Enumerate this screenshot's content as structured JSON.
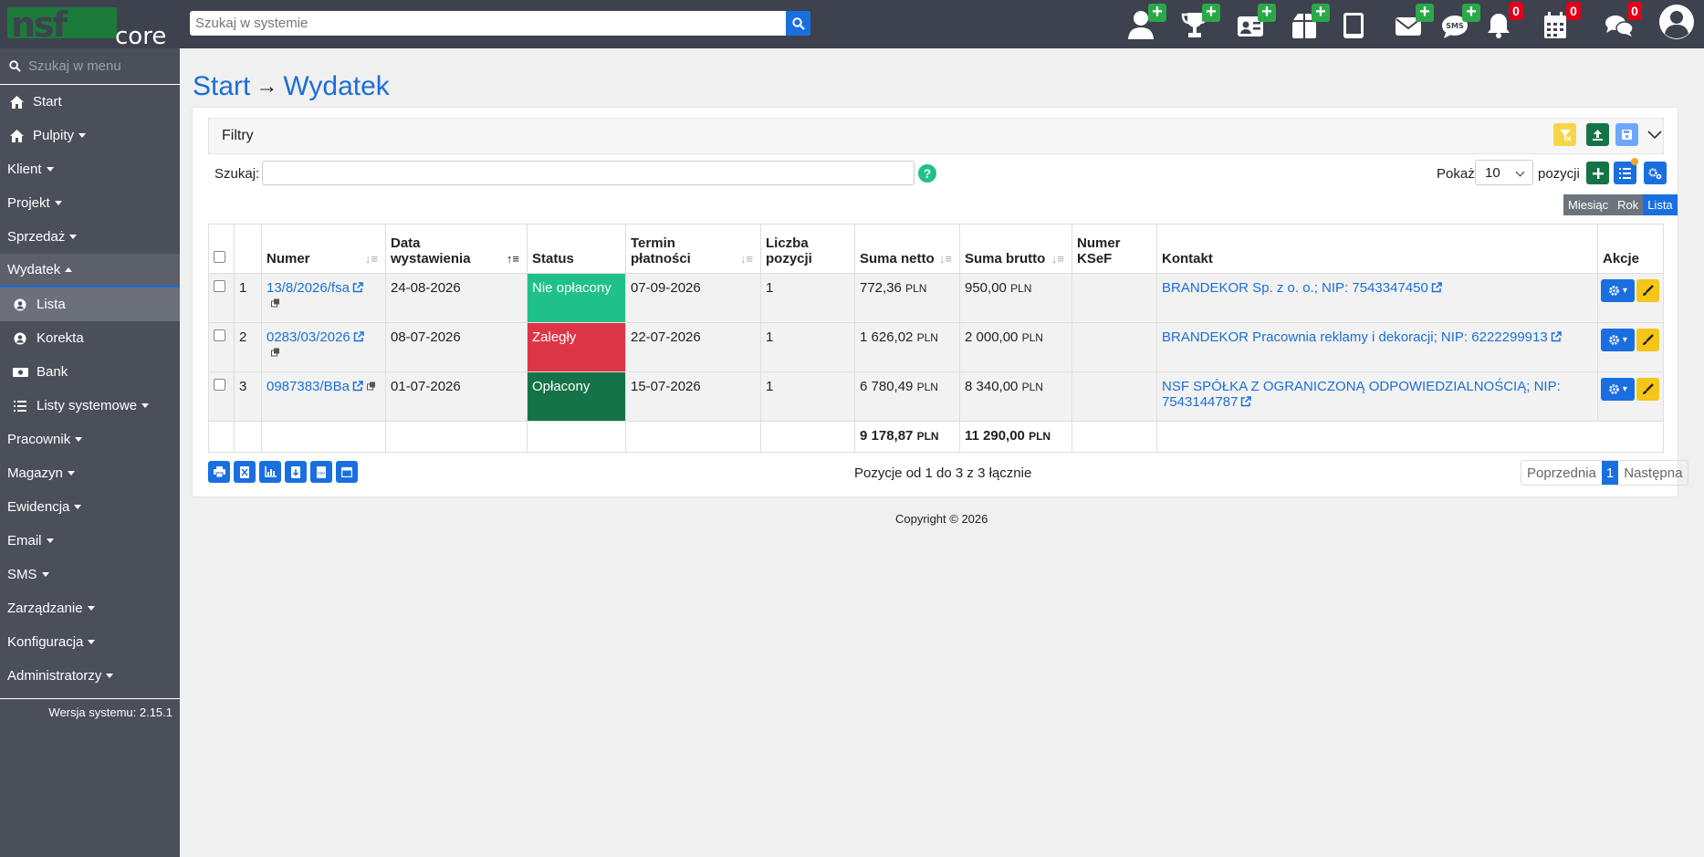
{
  "topbar": {
    "search_placeholder": "Szukaj w systemie",
    "badges": {
      "notifications": "0",
      "calendar": "0",
      "messages": "0"
    }
  },
  "sidebar": {
    "search_placeholder": "Szukaj w menu",
    "items": [
      {
        "label": "Start",
        "icon": "home-icon"
      },
      {
        "label": "Pulpity",
        "icon": "home-icon",
        "dropdown": true
      },
      {
        "label": "Klient",
        "dropdown": true
      },
      {
        "label": "Projekt",
        "dropdown": true
      },
      {
        "label": "Sprzedaż",
        "dropdown": true
      },
      {
        "label": "Wydatek",
        "dropdown": true,
        "expanded": true
      },
      {
        "label": "Lista",
        "icon": "person-icon",
        "sub": true,
        "active": true
      },
      {
        "label": "Korekta",
        "icon": "person-icon",
        "sub": true
      },
      {
        "label": "Bank",
        "icon": "money-icon",
        "sub": true
      },
      {
        "label": "Listy systemowe",
        "icon": "list-icon",
        "sub": true,
        "dropdown": true
      },
      {
        "label": "Pracownik",
        "dropdown": true
      },
      {
        "label": "Magazyn",
        "dropdown": true
      },
      {
        "label": "Ewidencja",
        "dropdown": true
      },
      {
        "label": "Email",
        "dropdown": true
      },
      {
        "label": "SMS",
        "dropdown": true
      },
      {
        "label": "Zarządzanie",
        "dropdown": true
      },
      {
        "label": "Konfiguracja",
        "dropdown": true
      },
      {
        "label": "Administratorzy",
        "dropdown": true
      }
    ],
    "version": "Wersja systemu: 2.15.1"
  },
  "breadcrumb": {
    "start": "Start",
    "current": "Wydatek"
  },
  "filters": {
    "title": "Filtry",
    "search_label": "Szukaj:",
    "help": "?",
    "show_label": "Pokaż",
    "page_size": "10",
    "positions_label": "pozycji",
    "views": [
      "Miesiąc",
      "Rok",
      "Lista"
    ],
    "active_view": "Lista"
  },
  "table": {
    "headers": {
      "numer": "Numer",
      "data": "Data wystawienia",
      "status": "Status",
      "termin": "Termin płatności",
      "liczba": "Liczba pozycji",
      "netto": "Suma netto",
      "brutto": "Suma brutto",
      "ksef": "Numer KSeF",
      "kontakt": "Kontakt",
      "akcje": "Akcje"
    },
    "rows": [
      {
        "lp": "1",
        "numer": "13/8/2026/fsa",
        "data": "24-08-2026",
        "status": "Nie opłacony",
        "termin": "07-09-2026",
        "liczba": "1",
        "netto": "772,36",
        "brutto": "950,00",
        "ksef": "",
        "kontakt": "BRANDEKOR Sp. z o. o.; NIP: 7543347450"
      },
      {
        "lp": "2",
        "numer": "0283/03/2026",
        "data": "08-07-2026",
        "status": "Zaległy",
        "termin": "22-07-2026",
        "liczba": "1",
        "netto": "1 626,02",
        "brutto": "2 000,00",
        "ksef": "",
        "kontakt": "BRANDEKOR Pracownia reklamy i dekoracji; NIP: 6222299913"
      },
      {
        "lp": "3",
        "numer": "0987383/BBa",
        "data": "01-07-2026",
        "status": "Opłacony",
        "termin": "15-07-2026",
        "liczba": "1",
        "netto": "6 780,49",
        "brutto": "8 340,00",
        "ksef": "",
        "kontakt": "NSF SPÓŁKA Z OGRANICZONĄ ODPOWIEDZIALNOŚCIĄ; NIP: 7543144787"
      }
    ],
    "currency": "PLN",
    "totals": {
      "netto": "9 178,87",
      "brutto": "11 290,00"
    }
  },
  "footer": {
    "info": "Pozycje od 1 do 3 z 3 łącznie",
    "prev": "Poprzednia",
    "page": "1",
    "next": "Następna",
    "copyright": "Copyright © 2026"
  },
  "colors": {
    "accent": "#1a6fe0",
    "topbar": "#3d424e",
    "sidebar": "#4b4f5a",
    "paid": "#157347",
    "unpaid": "#20c08a",
    "overdue": "#dc3545"
  }
}
